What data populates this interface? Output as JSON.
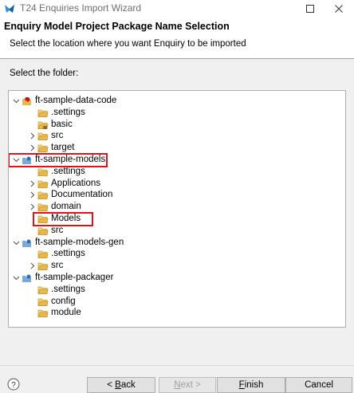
{
  "window": {
    "title": "T24 Enquiries Import Wizard"
  },
  "header": {
    "title": "Enquiry Model Project Package Name Selection",
    "description": "Select the location where you want Enquiry to be imported"
  },
  "main": {
    "select_label": "Select the folder:"
  },
  "tree": [
    {
      "label": "ft-sample-data-code",
      "kind": "project-data",
      "expanded": true,
      "depth": 0
    },
    {
      "label": ".settings",
      "kind": "folder",
      "depth": 1
    },
    {
      "label": "basic",
      "kind": "package-folder",
      "depth": 1
    },
    {
      "label": "src",
      "kind": "folder",
      "collapsed": true,
      "depth": 1
    },
    {
      "label": "target",
      "kind": "folder",
      "collapsed": true,
      "depth": 1
    },
    {
      "label": "ft-sample-models",
      "kind": "project-models",
      "expanded": true,
      "depth": 0,
      "highlighted": true
    },
    {
      "label": ".settings",
      "kind": "folder",
      "depth": 1
    },
    {
      "label": "Applications",
      "kind": "folder",
      "collapsed": true,
      "depth": 1
    },
    {
      "label": "Documentation",
      "kind": "folder",
      "collapsed": true,
      "depth": 1
    },
    {
      "label": "domain",
      "kind": "folder",
      "collapsed": true,
      "depth": 1
    },
    {
      "label": "Models",
      "kind": "folder",
      "depth": 1,
      "highlighted": true
    },
    {
      "label": "src",
      "kind": "folder",
      "depth": 1
    },
    {
      "label": "ft-sample-models-gen",
      "kind": "project-models",
      "expanded": true,
      "depth": 0
    },
    {
      "label": ".settings",
      "kind": "folder",
      "depth": 1
    },
    {
      "label": "src",
      "kind": "folder",
      "collapsed": true,
      "depth": 1
    },
    {
      "label": "ft-sample-packager",
      "kind": "project-models",
      "expanded": true,
      "depth": 0
    },
    {
      "label": ".settings",
      "kind": "folder",
      "depth": 1
    },
    {
      "label": "config",
      "kind": "folder",
      "depth": 1
    },
    {
      "label": "module",
      "kind": "folder",
      "depth": 1
    }
  ],
  "footer": {
    "help_icon": "question-mark-icon",
    "back_mnemonic": "B",
    "back_rest": "ack",
    "back_prefix": "< ",
    "next_mnemonic": "N",
    "next_rest": "ext >",
    "finish_mnemonic": "F",
    "finish_rest": "inish",
    "cancel_label": "Cancel"
  },
  "colors": {
    "highlight": "#d9161c",
    "folder": "#e8b84a",
    "accent": "#0078d7"
  }
}
